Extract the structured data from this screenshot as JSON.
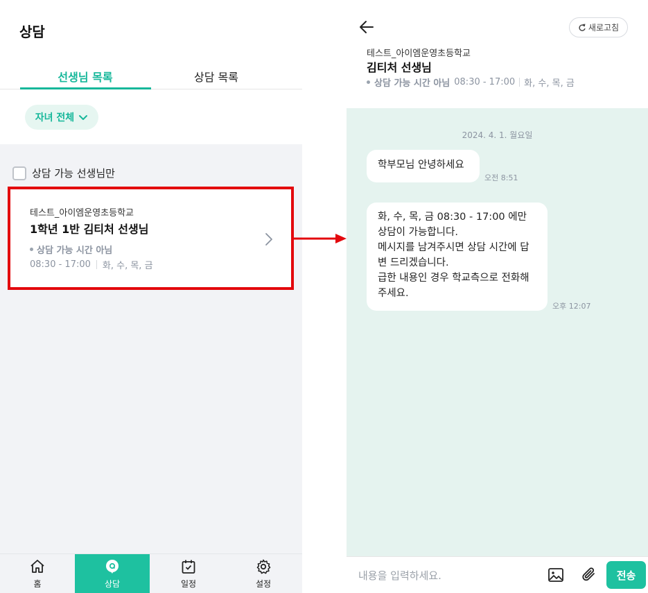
{
  "left": {
    "title": "상담",
    "tabs": [
      {
        "label": "선생님 목록",
        "active": true
      },
      {
        "label": "상담 목록",
        "active": false
      }
    ],
    "filter_chip": "자녀 전체",
    "checkbox_label": "상담 가능 선생님만",
    "teacher_card": {
      "school": "테스트_아이엠운영초등학교",
      "name": "1학년 1반 김티처 선생님",
      "status": "상담 가능 시간 아님",
      "hours": "08:30 - 17:00",
      "days": "화, 수, 목, 금"
    },
    "nav": [
      {
        "label": "홈",
        "icon": "home-icon"
      },
      {
        "label": "상담",
        "icon": "chat-bubble-icon",
        "active": true
      },
      {
        "label": "일정",
        "icon": "calendar-check-icon"
      },
      {
        "label": "설정",
        "icon": "gear-icon"
      }
    ]
  },
  "right": {
    "refresh_label": "새로고침",
    "school": "테스트_아이엠운영초등학교",
    "teacher_name": "김티처 선생님",
    "status": "상담 가능 시간 아님",
    "hours": "08:30 - 17:00",
    "days": "화, 수, 목, 금",
    "date": "2024. 4. 1. 월요일",
    "messages": [
      {
        "text_lines": [
          "학부모님 안녕하세요"
        ],
        "time": "오전 8:51"
      },
      {
        "text_lines": [
          "화, 수, 목, 금 08:30 - 17:00 에만",
          "상담이 가능합니다.",
          "메시지를 남겨주시면 상담 시간에 답",
          "변 드리겠습니다.",
          "급한 내용인 경우 학교측으로 전화해",
          "주세요."
        ],
        "time": "오후 12:07"
      }
    ],
    "input_placeholder": "내용을 입력하세요.",
    "send_label": "전송"
  },
  "colors": {
    "accent": "#1ec1a0",
    "accent_text": "#16b79a",
    "chat_bg": "#e5f3ef",
    "highlight": "#e3080d"
  }
}
